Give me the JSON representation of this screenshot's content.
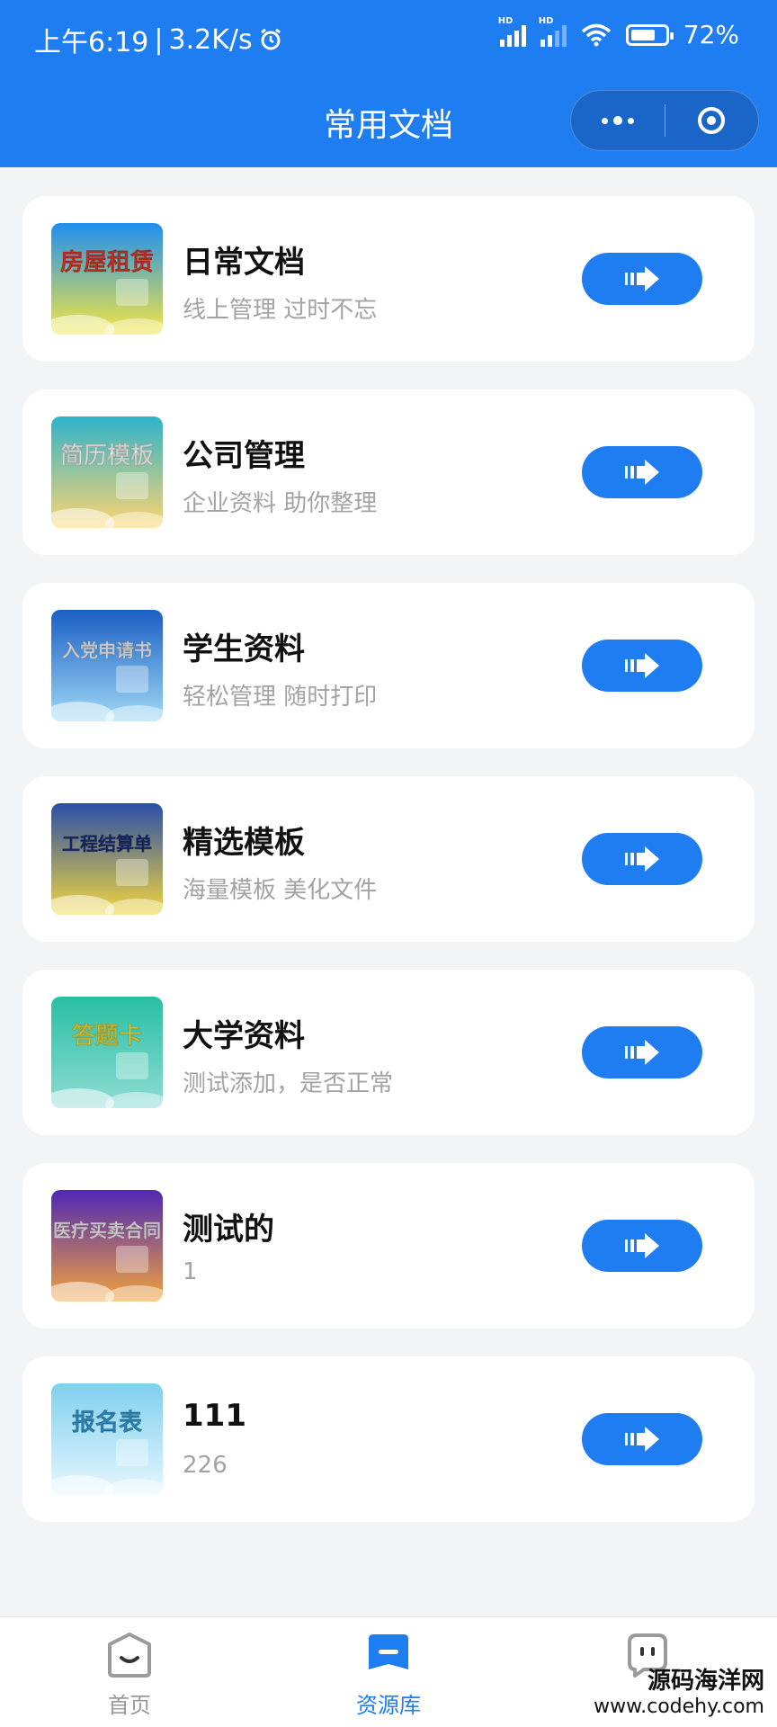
{
  "status_bar": {
    "time": "上午6:19",
    "speed": "3.2K/s",
    "battery": "72%",
    "battery_level": 0.72,
    "network_badge": "HD",
    "icons": [
      "alarm-icon",
      "signal-icon",
      "wifi-icon",
      "battery-icon"
    ]
  },
  "header": {
    "title": "常用文档",
    "capsule_icons": [
      "more-dots-icon",
      "close-ring-icon"
    ]
  },
  "documents": [
    {
      "title": "日常文档",
      "subtitle": "线上管理 过时不忘",
      "thumb_text": "房屋租赁",
      "thumb_colors": [
        "#1d8ff1",
        "#f5e640"
      ],
      "thumb_text_color": "#e63525",
      "thumb_icon": "house-rental-thumbnail"
    },
    {
      "title": "公司管理",
      "subtitle": "企业资料 助你整理",
      "thumb_text": "简历模板",
      "thumb_colors": [
        "#2db4c9",
        "#ffd470"
      ],
      "thumb_text_color": "#ffffff",
      "thumb_icon": "resume-template-thumbnail"
    },
    {
      "title": "学生资料",
      "subtitle": "轻松管理 随时打印",
      "thumb_text": "入党申请书",
      "thumb_colors": [
        "#1a5ec4",
        "#9fd8f5"
      ],
      "thumb_text_color": "#ffffff",
      "thumb_icon": "application-letter-thumbnail"
    },
    {
      "title": "精选模板",
      "subtitle": "海量模板 美化文件",
      "thumb_text": "工程结算单",
      "thumb_colors": [
        "#2a4fa8",
        "#f2d53d"
      ],
      "thumb_text_color": "#1d2f7a",
      "thumb_icon": "settlement-sheet-thumbnail"
    },
    {
      "title": "大学资料",
      "subtitle": "测试添加，是否正常",
      "thumb_text": "答题卡",
      "thumb_colors": [
        "#28bfa4",
        "#8fdcd3"
      ],
      "thumb_text_color": "#f4e03a",
      "thumb_icon": "answer-sheet-thumbnail"
    },
    {
      "title": "测试的",
      "subtitle": "1",
      "thumb_text": "医疗买卖合同",
      "thumb_colors": [
        "#4f28b5",
        "#f2a23b"
      ],
      "thumb_text_color": "#ffffff",
      "thumb_icon": "contract-thumbnail"
    },
    {
      "title": "111",
      "subtitle": "226",
      "thumb_text": "报名表",
      "thumb_colors": [
        "#7fd0ee",
        "#e8f7ff"
      ],
      "thumb_text_color": "#2f9bd6",
      "thumb_icon": "registration-form-thumbnail"
    }
  ],
  "action_icon": "arrow-right-icon",
  "tabbar": {
    "tabs": [
      {
        "label": "首页",
        "icon": "home-smile-icon",
        "active": false
      },
      {
        "label": "资源库",
        "icon": "library-icon",
        "active": true
      },
      {
        "label": "",
        "icon": "profile-face-icon",
        "active": false
      }
    ]
  },
  "watermark": {
    "line1": "源码海洋网",
    "line2": "www.codehy.com"
  },
  "colors": {
    "primary": "#1f7df2",
    "background": "#f3f4f6",
    "subtitle": "#a3a3a3"
  }
}
